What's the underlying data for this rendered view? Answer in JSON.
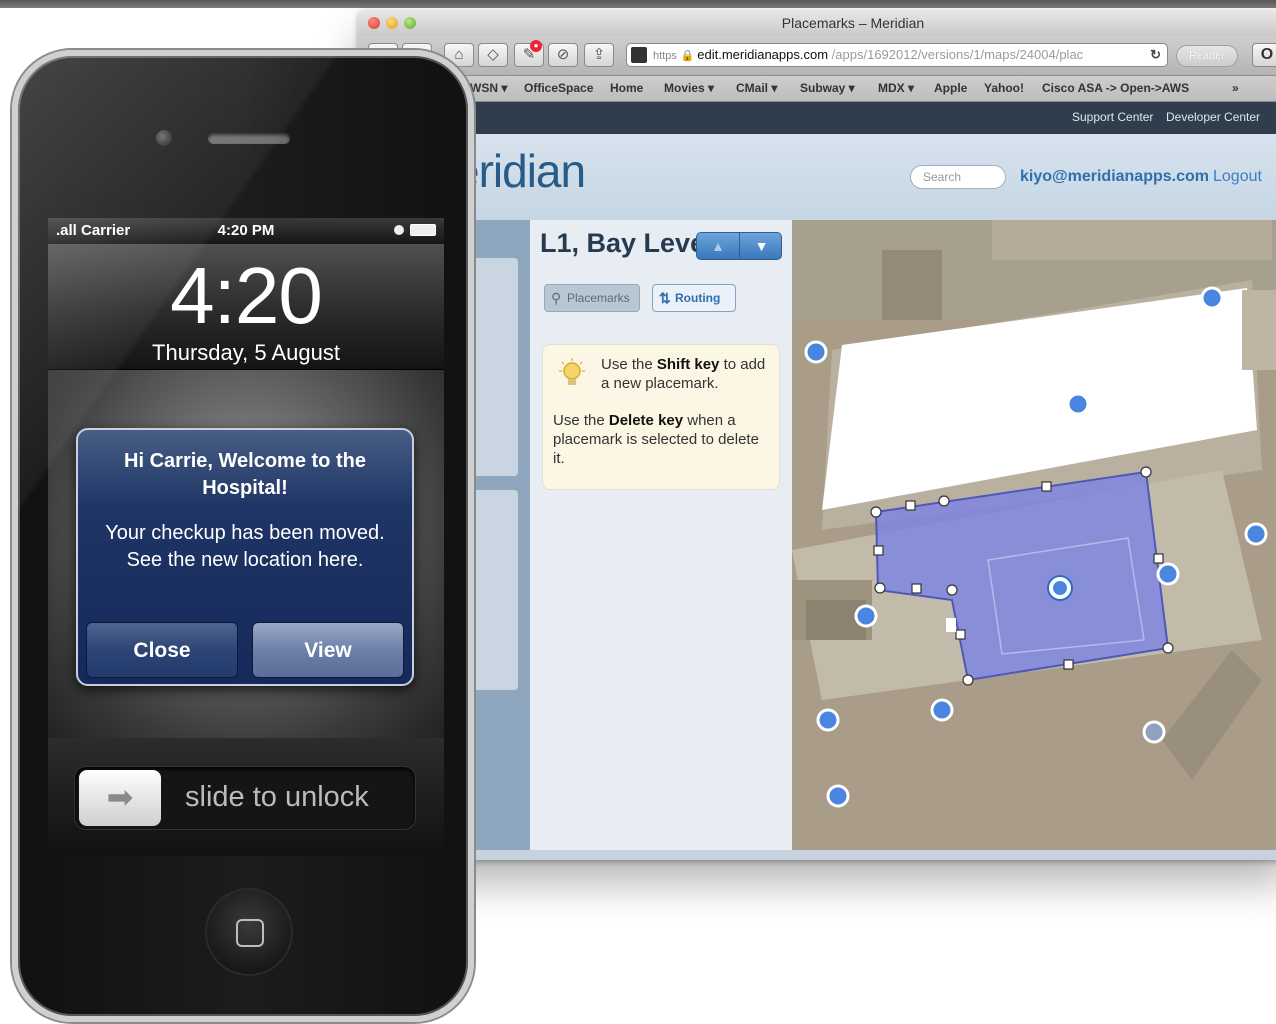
{
  "browser": {
    "window_title": "Placemarks – Meridian",
    "url": {
      "protocol": "https",
      "host": "edit.meridianapps.com",
      "path": "/apps/1692012/versions/1/maps/24004/plac"
    },
    "reader_label": "Reader",
    "bookmarks": [
      "WSN ▾",
      "OfficeSpace",
      "Home",
      "Movies ▾",
      "CMail ▾",
      "Subway ▾",
      "MDX ▾",
      "Apple",
      "Yahoo!",
      "Cisco ASA -> Open->AWS",
      "»"
    ]
  },
  "site": {
    "top_links": [
      "Support Center",
      "Developer Center"
    ],
    "logo": "eridian",
    "search_placeholder": "Search",
    "user_email": "kiyo@meridianapps.com",
    "logout": "Logout"
  },
  "editor": {
    "floor_name": "L1, Bay Level",
    "floor_up": "▲",
    "floor_down": "▼",
    "tabs": {
      "placemarks": "Placemarks",
      "routing": "Routing"
    },
    "tip": {
      "line1_prefix": "Use the ",
      "line1_key": "Shift key",
      "line1_suffix": " to add a new placemark.",
      "line2_prefix": "Use the ",
      "line2_key": "Delete key",
      "line2_suffix": " when a placemark is selected to delete it."
    }
  },
  "phone": {
    "status": {
      "carrier": ".all Carrier",
      "time": "4:20 PM"
    },
    "lock_time": "4:20",
    "lock_date": "Thursday, 5 August",
    "alert": {
      "title": "Hi Carrie, Welcome to the Hospital!",
      "message": "Your checkup has been moved. See the new location here.",
      "close": "Close",
      "view": "View"
    },
    "slide_to_unlock": "slide to unlock"
  },
  "colors": {
    "placemark_blue": "#4a86e0",
    "selection_fill": "#7f86e0",
    "alert_blue": "#1f3565",
    "site_nav": "#2f3d4c"
  }
}
